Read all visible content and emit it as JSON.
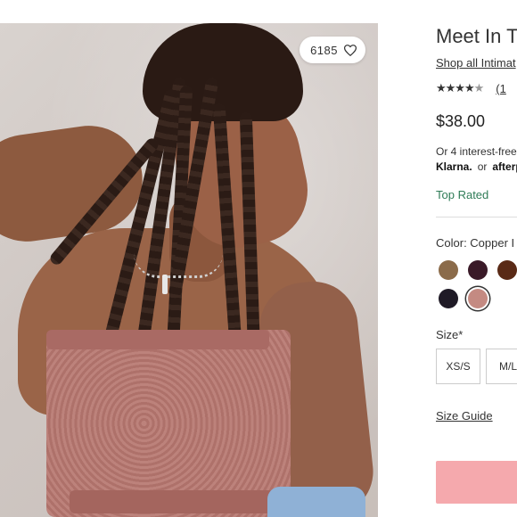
{
  "image": {
    "likes_count": "6185",
    "like_icon": "heart-icon"
  },
  "product": {
    "title": "Meet In T",
    "shop_link": "Shop all Intimat",
    "rating": {
      "stars_full": "★★★★",
      "stars_half": "★",
      "review_count": "(1"
    },
    "price": "$38.00",
    "installments_text": "Or 4 interest-free",
    "klarna_label": "Klarna.",
    "or_label": "or",
    "afterpay_label": "afterp",
    "badge": "Top Rated",
    "color_label": "Color: Copper I",
    "swatches": [
      {
        "color": "#8b6b4a",
        "selected": false
      },
      {
        "color": "#3a1a28",
        "selected": false
      },
      {
        "color": "#5a2a16",
        "selected": false
      },
      {
        "color": "#1f1a26",
        "selected": false
      },
      {
        "color": "#c48a82",
        "selected": true
      }
    ],
    "size_label": "Size*",
    "sizes": [
      "XS/S",
      "M/L"
    ],
    "size_guide": "Size Guide"
  },
  "colors": {
    "accent_pink": "#f5a9ad",
    "top_rated_green": "#2f7c57"
  }
}
